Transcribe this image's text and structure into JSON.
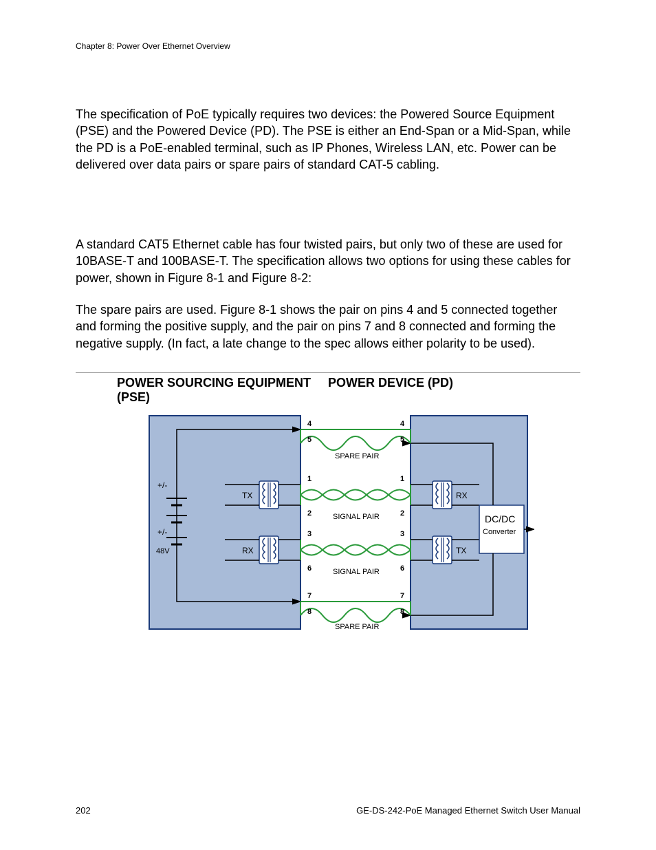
{
  "header": {
    "chapter": "Chapter 8: Power Over Ethernet Overview"
  },
  "paragraphs": {
    "p1": "The specification of PoE typically requires two devices: the Powered Source Equipment (PSE) and the Powered Device (PD). The PSE is either an End-Span or a Mid-Span, while the PD is a PoE-enabled terminal, such as IP Phones, Wireless LAN, etc. Power can be delivered over data pairs or spare pairs of standard CAT-5 cabling.",
    "p2": "A standard CAT5 Ethernet cable has four twisted pairs, but only two of these are used for 10BASE-T and 100BASE-T. The specification allows two options for using these cables for power, shown in Figure 8-1 and Figure 8-2:",
    "p3": "The spare pairs are used. Figure 8-1 shows the pair on pins 4 and 5 connected together and forming the positive supply, and the pair on pins 7 and 8 connected and forming the negative supply. (In fact, a late change to the spec allows either polarity to be used)."
  },
  "diagram": {
    "title_left": "POWER SOURCING EQUIPMENT (PSE)",
    "title_right": "POWER DEVICE (PD)",
    "labels": {
      "voltage": "48V",
      "polarity1": "+/-",
      "polarity2": "+/-",
      "tx": "TX",
      "rx": "RX",
      "spare_pair": "SPARE PAIR",
      "signal_pair": "SIGNAL PAIR",
      "converter_l1": "DC/DC",
      "converter_l2": "Converter",
      "pin1": "1",
      "pin2": "2",
      "pin3": "3",
      "pin4": "4",
      "pin5": "5",
      "pin6": "6",
      "pin7": "7",
      "pin8": "8"
    }
  },
  "footer": {
    "page_num": "202",
    "manual": "GE-DS-242-PoE Managed Ethernet Switch User Manual"
  }
}
